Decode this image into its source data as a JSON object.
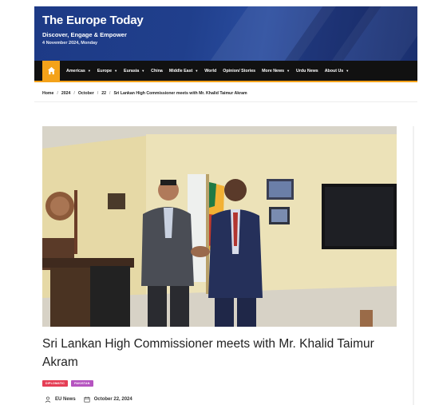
{
  "header": {
    "site_title": "The Europe Today",
    "tagline": "Discover, Engage & Empower",
    "date": "4 November 2024, Monday"
  },
  "nav": {
    "home_icon": "home-icon",
    "items": [
      {
        "label": "Americas",
        "has_dropdown": true
      },
      {
        "label": "Europe",
        "has_dropdown": true
      },
      {
        "label": "Eurasia",
        "has_dropdown": true
      },
      {
        "label": "China",
        "has_dropdown": false
      },
      {
        "label": "Middle East",
        "has_dropdown": true
      },
      {
        "label": "World",
        "has_dropdown": false
      },
      {
        "label": "Opinion/ Stories",
        "has_dropdown": false
      },
      {
        "label": "More News",
        "has_dropdown": true
      },
      {
        "label": "Urdu News",
        "has_dropdown": false
      },
      {
        "label": "About Us",
        "has_dropdown": true
      }
    ],
    "accent_color": "#f4a21a"
  },
  "breadcrumb": [
    "Home",
    "2024",
    "October",
    "22",
    "Sri Lankan High Commissioner meets with Mr. Khalid Taimur Akram"
  ],
  "post": {
    "title": "Sri Lankan High Commissioner meets with Mr. Khalid Taimur Akram",
    "tags": [
      {
        "label": "DIPLOMATIC",
        "color": "#e53e55"
      },
      {
        "label": "PAKISTAN",
        "color": "#b554c0"
      }
    ],
    "author": "EU News",
    "date": "October 22, 2024",
    "author_icon": "user-icon",
    "date_icon": "calendar-icon"
  }
}
